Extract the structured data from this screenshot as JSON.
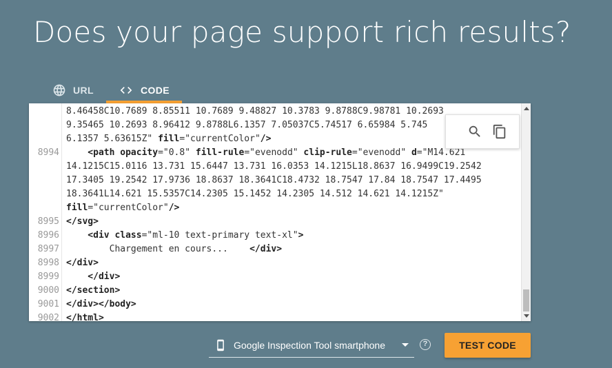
{
  "header": {
    "title": "Does your page support rich results?"
  },
  "tabs": [
    {
      "label": "URL",
      "icon": "globe-icon",
      "active": false
    },
    {
      "label": "CODE",
      "icon": "code-brackets-icon",
      "active": true
    }
  ],
  "editor": {
    "lines": [
      {
        "num": "",
        "segments": [
          {
            "t": "8.46458C10.7689 8.85511 10.7689 9.48827 10.3783 9.8788C9.98781 10.2693",
            "c": "val"
          }
        ]
      },
      {
        "num": "",
        "segments": [
          {
            "t": "9.35465 10.2693 8.96412 9.8788L6.1357 7.05037C5.74517 6.65984 5.745",
            "c": "val"
          }
        ]
      },
      {
        "num": "",
        "segments": [
          {
            "t": "6.1357 5.63615Z\" ",
            "c": "val"
          },
          {
            "t": "fill",
            "c": "attr"
          },
          {
            "t": "=\"currentColor\"",
            "c": "val"
          },
          {
            "t": "/>",
            "c": "tag"
          }
        ]
      },
      {
        "num": "8994",
        "segments": [
          {
            "t": "    <path ",
            "c": "tag"
          },
          {
            "t": "opacity",
            "c": "attr"
          },
          {
            "t": "=\"0.8\" ",
            "c": "val"
          },
          {
            "t": "fill-rule",
            "c": "attr"
          },
          {
            "t": "=\"evenodd\" ",
            "c": "val"
          },
          {
            "t": "clip-rule",
            "c": "attr"
          },
          {
            "t": "=\"evenodd\" ",
            "c": "val"
          },
          {
            "t": "d",
            "c": "attr"
          },
          {
            "t": "=\"M14.621",
            "c": "val"
          }
        ]
      },
      {
        "num": "",
        "segments": [
          {
            "t": "14.1215C15.0116 13.731 15.6447 13.731 16.0353 14.1215L18.8637 16.9499C19.2542",
            "c": "val"
          }
        ]
      },
      {
        "num": "",
        "segments": [
          {
            "t": "17.3405 19.2542 17.9736 18.8637 18.3641C18.4732 18.7547 17.84 18.7547 17.4495",
            "c": "val"
          }
        ]
      },
      {
        "num": "",
        "segments": [
          {
            "t": "18.3641L14.621 15.5357C14.2305 15.1452 14.2305 14.512 14.621 14.1215Z\"",
            "c": "val"
          }
        ]
      },
      {
        "num": "",
        "segments": [
          {
            "t": "fill",
            "c": "attr"
          },
          {
            "t": "=\"currentColor\"",
            "c": "val"
          },
          {
            "t": "/>",
            "c": "tag"
          }
        ]
      },
      {
        "num": "8995",
        "segments": [
          {
            "t": "</svg>",
            "c": "tag"
          }
        ]
      },
      {
        "num": "8996",
        "segments": [
          {
            "t": "    <div ",
            "c": "tag"
          },
          {
            "t": "class",
            "c": "attr"
          },
          {
            "t": "=\"ml-10 text-primary text-xl\"",
            "c": "val"
          },
          {
            "t": ">",
            "c": "tag"
          }
        ]
      },
      {
        "num": "8997",
        "segments": [
          {
            "t": "        Chargement en cours...    ",
            "c": "val"
          },
          {
            "t": "</div>",
            "c": "tag"
          }
        ]
      },
      {
        "num": "8998",
        "segments": [
          {
            "t": "</div>",
            "c": "tag"
          }
        ]
      },
      {
        "num": "8999",
        "segments": [
          {
            "t": "    </div>",
            "c": "tag"
          }
        ]
      },
      {
        "num": "9000",
        "segments": [
          {
            "t": "</section>",
            "c": "tag"
          }
        ]
      },
      {
        "num": "9001",
        "segments": [
          {
            "t": "</div></body>",
            "c": "tag"
          }
        ]
      },
      {
        "num": "9002",
        "segments": [
          {
            "t": "</html>",
            "c": "tag"
          }
        ]
      }
    ],
    "tools": [
      {
        "icon": "search-icon"
      },
      {
        "icon": "copy-icon"
      }
    ]
  },
  "footer": {
    "device_label": "Google Inspection Tool smartphone",
    "device_icon": "smartphone-icon",
    "help_label": "?",
    "test_button": "TEST CODE"
  },
  "colors": {
    "background": "#5f7d8b",
    "accent": "#f7a133"
  }
}
